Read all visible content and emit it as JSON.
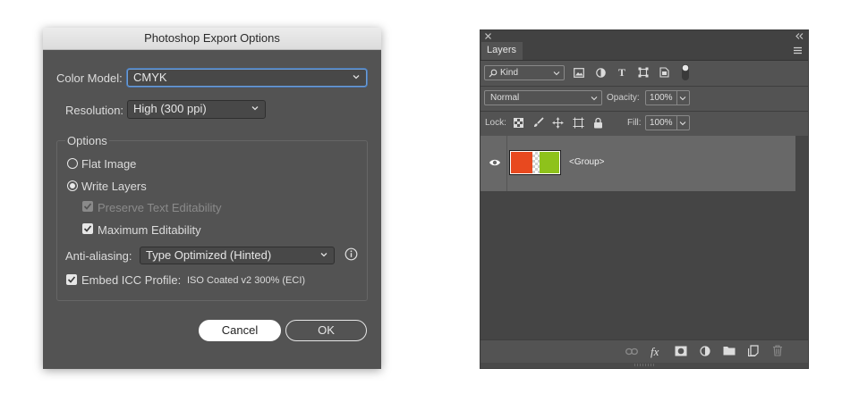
{
  "export_dialog": {
    "title": "Photoshop Export Options",
    "color_model_label": "Color Model:",
    "color_model_value": "CMYK",
    "resolution_label": "Resolution:",
    "resolution_value": "High (300 ppi)",
    "options_title": "Options",
    "flat_image_label": "Flat Image",
    "write_layers_label": "Write Layers",
    "selected_mode": "write-layers",
    "preserve_text_label": "Preserve Text Editability",
    "preserve_text_checked": true,
    "preserve_text_enabled": false,
    "max_edit_label": "Maximum Editability",
    "max_edit_checked": true,
    "anti_alias_label": "Anti-aliasing:",
    "anti_alias_value": "Type Optimized (Hinted)",
    "embed_icc_label": "Embed ICC Profile:",
    "embed_icc_checked": true,
    "icc_profile_name": "ISO Coated v2 300% (ECI)",
    "cancel_label": "Cancel",
    "ok_label": "OK"
  },
  "layers_panel": {
    "tab_label": "Layers",
    "filter_kind": "Kind",
    "blend_mode": "Normal",
    "opacity_label": "Opacity:",
    "opacity_value": "100%",
    "lock_label": "Lock:",
    "fill_label": "Fill:",
    "fill_value": "100%",
    "layer_name": "<Group>",
    "thumb_colors": {
      "left": "#e8491f",
      "right": "#8ec21b"
    }
  }
}
